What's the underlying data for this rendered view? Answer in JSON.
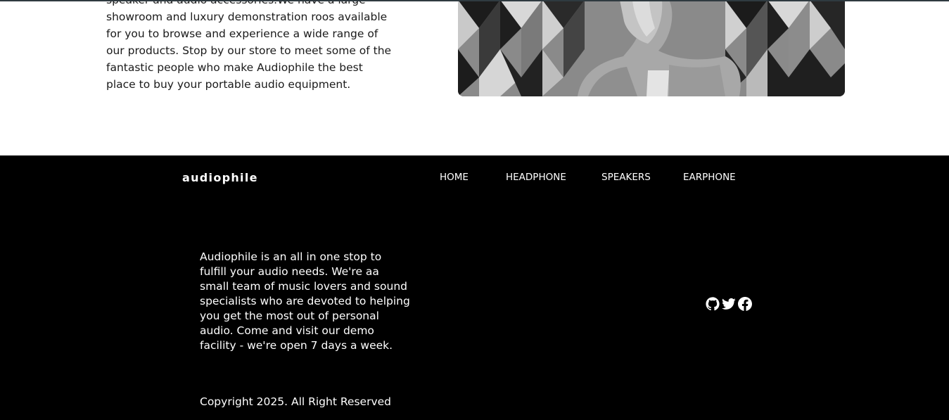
{
  "about": {
    "paragraph": "speaker and audio accessories.We have a large showroom and luxury demonstration roos available for you to browse and experience a wide range of our products. Stop by our store to meet some of the fantastic people who make Audiophile the best place to buy your portable audio equipment."
  },
  "footer": {
    "brand": "audiophile",
    "nav": [
      "HOME",
      "HEADPHONE",
      "SPEAKERS",
      "EARPHONE"
    ],
    "description": "Audiophile is an all in one stop to fulfill your audio needs. We're aa small team of music lovers and sound specialists who are devoted to helping you get the most out of personal audio. Come and visit our demo facility - we're open 7 days a week.",
    "social_icons": [
      "github-icon",
      "twitter-icon",
      "facebook-icon"
    ],
    "copyright": "Copyright 2025. All Right Reserved"
  },
  "colors": {
    "footer_bg": "#000000",
    "page_bg": "#ffffff",
    "text_dark": "#1a1a1a"
  }
}
